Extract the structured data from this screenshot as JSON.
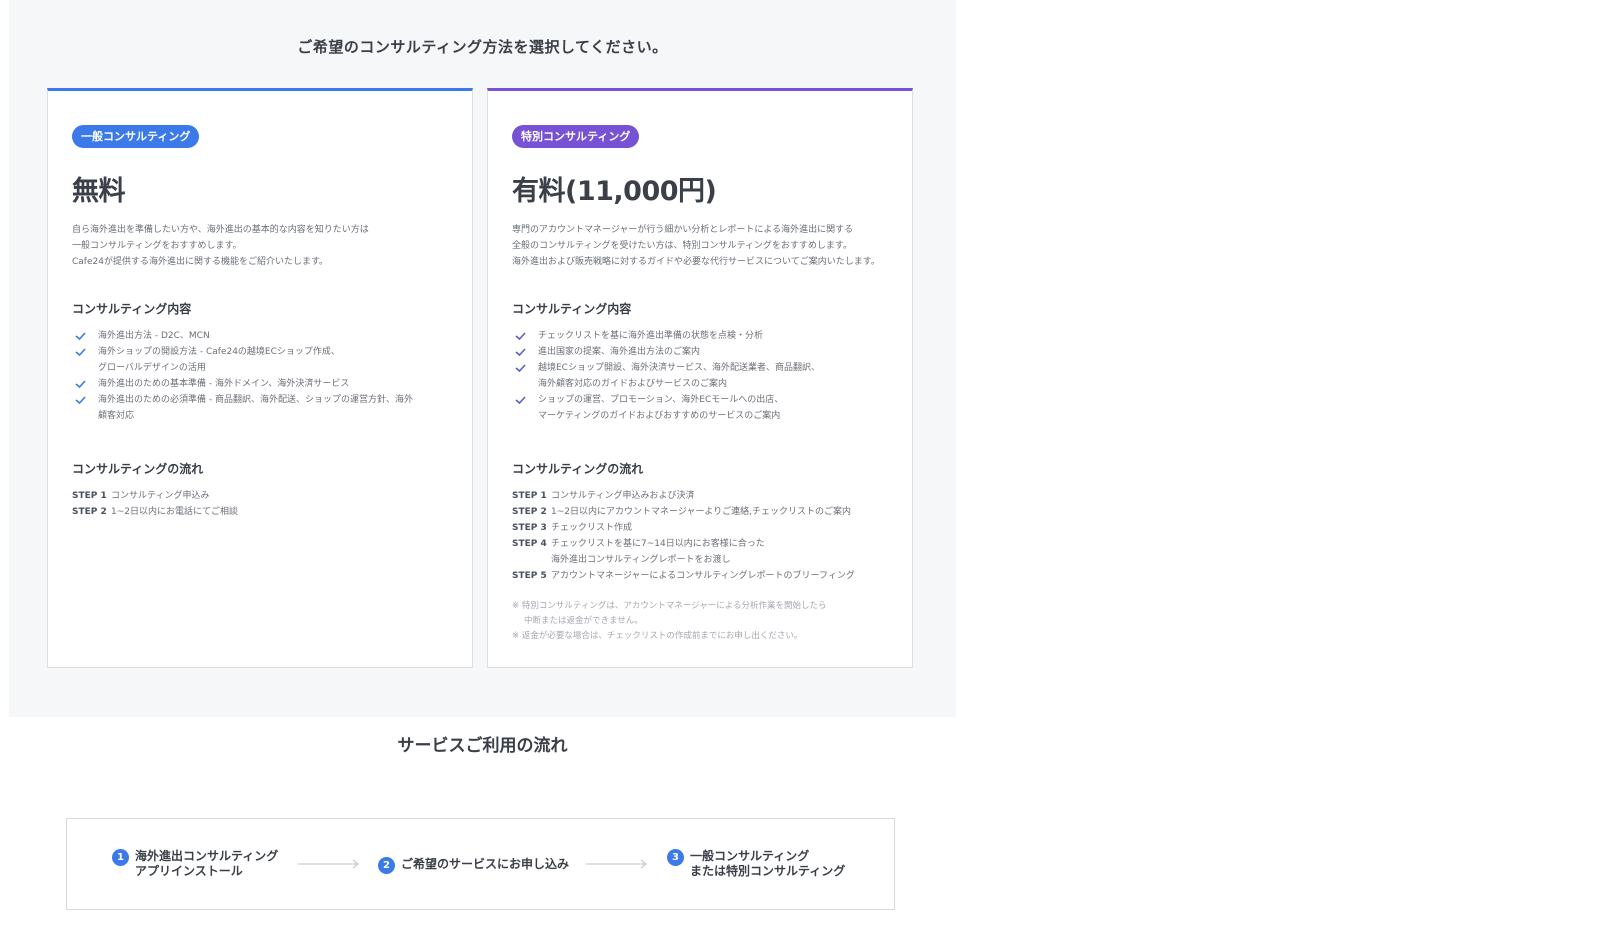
{
  "headings": {
    "choose": "ご希望のコンサルティング方法を選択してください。",
    "service_flow": "サービスご利用の流れ"
  },
  "colors": {
    "general_accent": "#3b7ae8",
    "special_accent": "#7752d4",
    "page_bg": "#f6f7f9"
  },
  "general": {
    "badge": "一般コンサルティング",
    "price": "無料",
    "desc": [
      "自ら海外進出を準備したい方や、海外進出の基本的な内容を知りたい方は",
      "一般コンサルティングをおすすめします。",
      "Cafe24が提供する海外進出に関する機能をご紹介いたします。"
    ],
    "content_heading": "コンサルティング内容",
    "content_items": [
      {
        "line1": "海外進出方法 - D2C、MCN",
        "line2": ""
      },
      {
        "line1": "海外ショップの開設方法 - Cafe24の越境ECショップ作成、",
        "line2": "グローバルデザインの活用"
      },
      {
        "line1": "海外進出のための基本準備 - 海外ドメイン、海外決済サービス",
        "line2": ""
      },
      {
        "line1": "海外進出のための必須準備 - 商品翻訳、海外配送、ショップの運営方針、海外",
        "line2": "顧客対応"
      }
    ],
    "flow_heading": "コンサルティングの流れ",
    "steps": [
      {
        "label": "STEP 1",
        "text": "コンサルティング申込み",
        "sub": ""
      },
      {
        "label": "STEP 2",
        "text": "1~2日以内にお電話にてご相談",
        "sub": ""
      }
    ]
  },
  "special": {
    "badge": "特別コンサルティング",
    "price": "有料(11,000円)",
    "desc": [
      "専門のアカウントマネージャーが行う細かい分析とレポートによる海外進出に関する",
      "全般のコンサルティングを受けたい方は、特別コンサルティングをおすすめします。",
      "海外進出および販売戦略に対するガイドや必要な代行サービスについてご案内いたします。"
    ],
    "content_heading": "コンサルティング内容",
    "content_items": [
      {
        "line1": "チェックリストを基に海外進出準備の状態を点検・分析",
        "line2": ""
      },
      {
        "line1": "進出国家の提案、海外進出方法のご案内",
        "line2": ""
      },
      {
        "line1": "越境ECショップ開設、海外決済サービス、海外配送業者、商品翻訳、",
        "line2": "海外顧客対応のガイドおよびサービスのご案内"
      },
      {
        "line1": "ショップの運営、プロモーション、海外ECモールへの出店、",
        "line2": "マーケティングのガイドおよびおすすめのサービスのご案内"
      }
    ],
    "flow_heading": "コンサルティングの流れ",
    "steps": [
      {
        "label": "STEP 1",
        "text": "コンサルティング申込みおよび決済",
        "sub": ""
      },
      {
        "label": "STEP 2",
        "text": "1~2日以内にアカウントマネージャーよりご連絡,チェックリストのご案内",
        "sub": ""
      },
      {
        "label": "STEP 3",
        "text": "チェックリスト作成",
        "sub": ""
      },
      {
        "label": "STEP 4",
        "text": "チェックリストを基に7~14日以内にお客様に合った",
        "sub": "海外進出コンサルティングレポートをお渡し"
      },
      {
        "label": "STEP 5",
        "text": "アカウントマネージャーによるコンサルティングレポートのブリーフィング",
        "sub": ""
      }
    ],
    "notes": [
      "※ 特別コンサルティングは、アカウントマネージャーによる分析作業を開始したら",
      "中断または返金ができません。",
      "※ 返金が必要な場合は、チェックリストの作成前までにお申し出ください。"
    ]
  },
  "service_flow": {
    "steps": [
      {
        "num": "1",
        "line1": "海外進出コンサルティング",
        "line2": "アプリインストール"
      },
      {
        "num": "2",
        "line1": "ご希望のサービスにお申し込み",
        "line2": ""
      },
      {
        "num": "3",
        "line1": "一般コンサルティング",
        "line2": "または特別コンサルティング"
      }
    ]
  }
}
